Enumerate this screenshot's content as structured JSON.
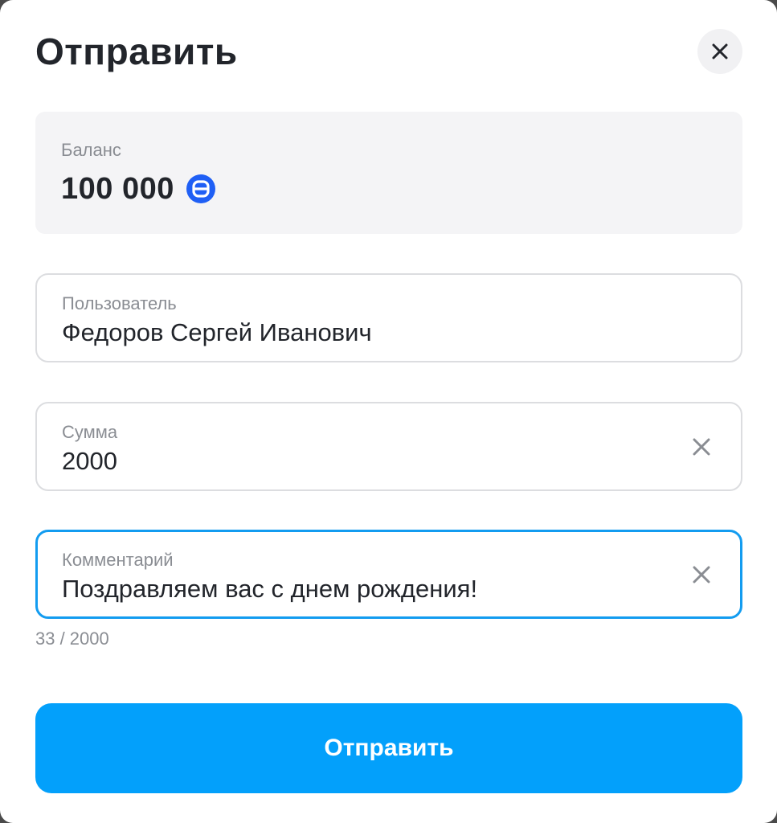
{
  "dialog": {
    "title": "Отправить",
    "close_icon": "close-icon"
  },
  "balance": {
    "label": "Баланс",
    "value": "100 000",
    "currency_icon": "coin-icon",
    "currency_color": "#1f5ff5"
  },
  "fields": {
    "user": {
      "label": "Пользователь",
      "value": "Федоров Сергей Иванович"
    },
    "amount": {
      "label": "Сумма",
      "value": "2000",
      "clear_icon": "clear-icon"
    },
    "comment": {
      "label": "Комментарий",
      "value": "Поздравляем вас с днем рождения!",
      "clear_icon": "clear-icon",
      "counter": "33 / 2000",
      "focused": true
    }
  },
  "submit": {
    "label": "Отправить"
  },
  "colors": {
    "accent": "#03a0fb",
    "focus_border": "#139cf0",
    "text_primary": "#22252b",
    "text_secondary": "#8a8d93",
    "card_bg": "#f4f4f6"
  }
}
